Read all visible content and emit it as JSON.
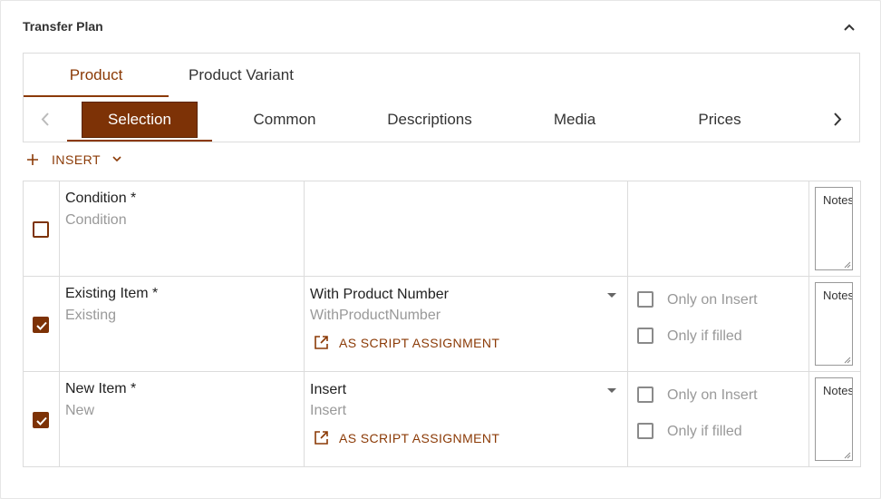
{
  "panel": {
    "title": "Transfer Plan"
  },
  "tabs_top": [
    {
      "label": "Product"
    },
    {
      "label": "Product Variant"
    }
  ],
  "tabs_sub": [
    {
      "label": "Selection"
    },
    {
      "label": "Common"
    },
    {
      "label": "Descriptions"
    },
    {
      "label": "Media"
    },
    {
      "label": "Prices"
    }
  ],
  "toolbar": {
    "insert_label": "INSERT"
  },
  "rows": [
    {
      "checked": false,
      "label": "Condition *",
      "value": "Condition",
      "notes_placeholder": "Notes"
    },
    {
      "checked": true,
      "label": "Existing Item *",
      "value": "Existing",
      "select_display": "With Product Number",
      "select_value": "WithProductNumber",
      "script_label": "AS SCRIPT ASSIGNMENT",
      "opt_insert": "Only on Insert",
      "opt_filled": "Only if filled",
      "notes_placeholder": "Notes"
    },
    {
      "checked": true,
      "label": "New Item *",
      "value": "New",
      "select_display": "Insert",
      "select_value": "Insert",
      "script_label": "AS SCRIPT ASSIGNMENT",
      "opt_insert": "Only on Insert",
      "opt_filled": "Only if filled",
      "notes_placeholder": "Notes"
    }
  ],
  "colors": {
    "accent": "#7d3206",
    "link": "#8b3a06",
    "muted": "#999999",
    "border": "#dcdcdc"
  }
}
